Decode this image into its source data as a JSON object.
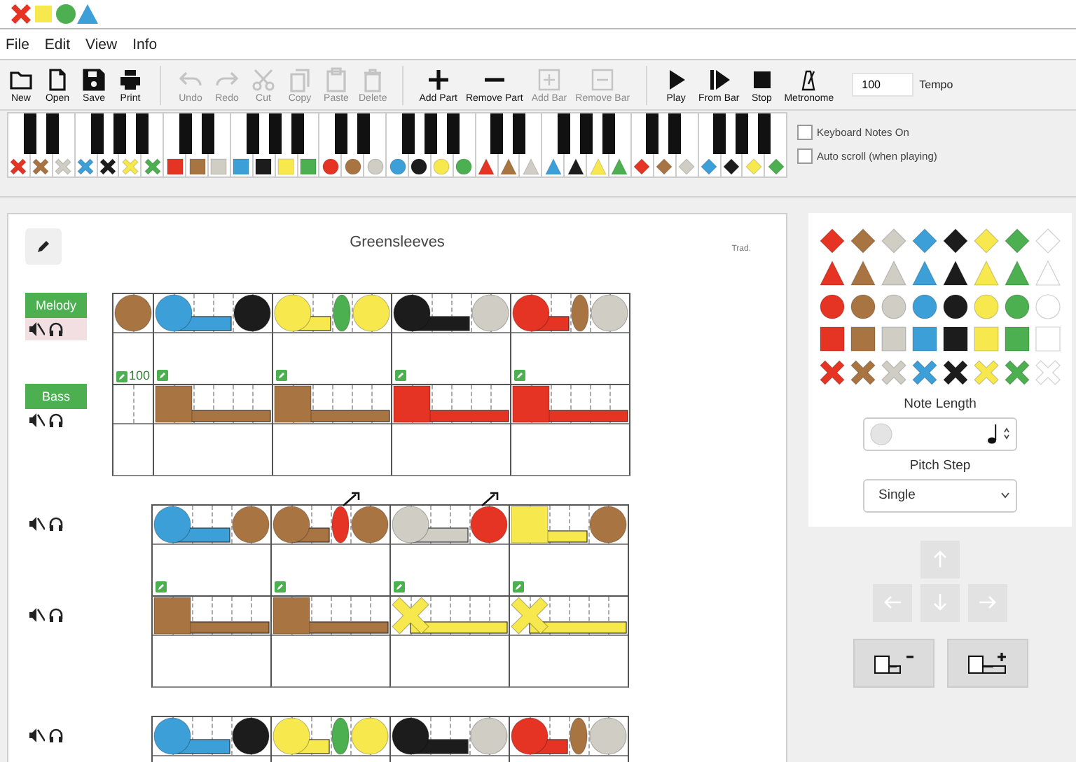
{
  "menu": [
    {
      "label": "File"
    },
    {
      "label": "Edit"
    },
    {
      "label": "View"
    },
    {
      "label": "Info"
    }
  ],
  "toolbar": {
    "groups": [
      {
        "items": [
          {
            "label": "New",
            "disabled": false
          },
          {
            "label": "Open",
            "disabled": false
          },
          {
            "label": "Save",
            "disabled": false
          },
          {
            "label": "Print",
            "disabled": false
          }
        ]
      },
      {
        "items": [
          {
            "label": "Undo",
            "disabled": true
          },
          {
            "label": "Redo",
            "disabled": true
          },
          {
            "label": "Cut",
            "disabled": true
          },
          {
            "label": "Copy",
            "disabled": true
          },
          {
            "label": "Paste",
            "disabled": true
          },
          {
            "label": "Delete",
            "disabled": true
          }
        ]
      },
      {
        "items": [
          {
            "label": "Add Part",
            "disabled": false
          },
          {
            "label": "Remove Part",
            "disabled": false
          },
          {
            "label": "Add Bar",
            "disabled": true
          },
          {
            "label": "Remove Bar",
            "disabled": true
          }
        ]
      },
      {
        "items": [
          {
            "label": "Play",
            "disabled": false
          },
          {
            "label": "From Bar",
            "disabled": false
          },
          {
            "label": "Stop",
            "disabled": false
          },
          {
            "label": "Metronome",
            "disabled": false
          }
        ]
      }
    ],
    "tempo": {
      "value": "100",
      "label": "Tempo"
    }
  },
  "keyboard": {
    "keys": [
      {
        "kind": "cross",
        "color": "#e53424"
      },
      {
        "kind": "cross",
        "color": "#a87542"
      },
      {
        "kind": "cross",
        "color": "#cfcdc4"
      },
      {
        "kind": "cross",
        "color": "#3d9fd8"
      },
      {
        "kind": "cross",
        "color": "#1c1c1c"
      },
      {
        "kind": "cross",
        "color": "#f7e84e"
      },
      {
        "kind": "cross",
        "color": "#4caf50"
      },
      {
        "kind": "square",
        "color": "#e53424"
      },
      {
        "kind": "square",
        "color": "#a87542"
      },
      {
        "kind": "square",
        "color": "#cfcdc4"
      },
      {
        "kind": "square",
        "color": "#3d9fd8"
      },
      {
        "kind": "square",
        "color": "#1c1c1c"
      },
      {
        "kind": "square",
        "color": "#f7e84e"
      },
      {
        "kind": "square",
        "color": "#4caf50"
      },
      {
        "kind": "circle",
        "color": "#e53424"
      },
      {
        "kind": "circle",
        "color": "#a87542"
      },
      {
        "kind": "circle",
        "color": "#cfcdc4"
      },
      {
        "kind": "circle",
        "color": "#3d9fd8"
      },
      {
        "kind": "circle",
        "color": "#1c1c1c"
      },
      {
        "kind": "circle",
        "color": "#f7e84e"
      },
      {
        "kind": "circle",
        "color": "#4caf50"
      },
      {
        "kind": "triangle",
        "color": "#e53424"
      },
      {
        "kind": "triangle",
        "color": "#a87542"
      },
      {
        "kind": "triangle",
        "color": "#cfcdc4"
      },
      {
        "kind": "triangle",
        "color": "#3d9fd8"
      },
      {
        "kind": "triangle",
        "color": "#1c1c1c"
      },
      {
        "kind": "triangle",
        "color": "#f7e84e"
      },
      {
        "kind": "triangle",
        "color": "#4caf50"
      },
      {
        "kind": "diamond",
        "color": "#e53424"
      },
      {
        "kind": "diamond",
        "color": "#a87542"
      },
      {
        "kind": "diamond",
        "color": "#cfcdc4"
      },
      {
        "kind": "diamond",
        "color": "#3d9fd8"
      },
      {
        "kind": "diamond",
        "color": "#1c1c1c"
      },
      {
        "kind": "diamond",
        "color": "#f7e84e"
      },
      {
        "kind": "diamond",
        "color": "#4caf50"
      }
    ],
    "options": [
      {
        "label": "Keyboard Notes On",
        "checked": false
      },
      {
        "label": "Auto scroll (when playing)",
        "checked": false
      }
    ]
  },
  "score": {
    "title": "Greensleeves",
    "composer": "Trad.",
    "systems": [
      {
        "parts": [
          {
            "name": "Melody",
            "selected": true,
            "bars": [
              {
                "kind": "pickup",
                "notes": [
                  {
                    "kind": "circle-quarter",
                    "color": "#a87542",
                    "raised": false
                  }
                ]
              },
              {
                "kind": "full",
                "notes": [
                  {
                    "kind": "circle-half",
                    "color": "#3d9fd8",
                    "raised": false
                  },
                  {
                    "kind": "circle-quarter",
                    "color": "#1c1c1c",
                    "raised": false
                  }
                ]
              },
              {
                "kind": "full",
                "notes": [
                  {
                    "kind": "circle-dotted-quarter",
                    "color": "#f7e84e",
                    "raised": false
                  },
                  {
                    "kind": "circle-eighth",
                    "color": "#4caf50",
                    "raised": false
                  },
                  {
                    "kind": "circle-quarter",
                    "color": "#f7e84e",
                    "raised": false
                  }
                ]
              },
              {
                "kind": "full",
                "notes": [
                  {
                    "kind": "circle-half",
                    "color": "#1c1c1c",
                    "raised": false
                  },
                  {
                    "kind": "circle-quarter",
                    "color": "#cfcdc4",
                    "raised": false
                  }
                ]
              },
              {
                "kind": "full",
                "notes": [
                  {
                    "kind": "circle-dotted-quarter",
                    "color": "#e53424",
                    "raised": false
                  },
                  {
                    "kind": "circle-eighth",
                    "color": "#a87542",
                    "raised": false
                  },
                  {
                    "kind": "circle-quarter",
                    "color": "#cfcdc4",
                    "raised": false
                  }
                ]
              }
            ]
          },
          {
            "name": "Bass",
            "selected": false,
            "bars": [
              {
                "kind": "pickup",
                "marker": true,
                "marker_label": "100"
              },
              {
                "kind": "full",
                "marker": true,
                "notes": [
                  {
                    "kind": "square-dotted-half",
                    "color": "#a87542",
                    "raised": false
                  }
                ]
              },
              {
                "kind": "full",
                "marker": true,
                "notes": [
                  {
                    "kind": "square-dotted-half",
                    "color": "#a87542",
                    "raised": false
                  }
                ]
              },
              {
                "kind": "full",
                "marker": true,
                "notes": [
                  {
                    "kind": "square-dotted-half",
                    "color": "#e53424",
                    "raised": false
                  }
                ]
              },
              {
                "kind": "full",
                "marker": true,
                "notes": [
                  {
                    "kind": "square-dotted-half",
                    "color": "#e53424",
                    "raised": false
                  }
                ]
              }
            ]
          }
        ]
      },
      {
        "parts": [
          {
            "selected": false,
            "bars": [
              {
                "kind": "full",
                "notes": [
                  {
                    "kind": "circle-half",
                    "color": "#3d9fd8",
                    "raised": false
                  },
                  {
                    "kind": "circle-quarter",
                    "color": "#a87542",
                    "raised": false
                  }
                ]
              },
              {
                "kind": "full",
                "notes": [
                  {
                    "kind": "circle-dotted-quarter",
                    "color": "#a87542",
                    "raised": false
                  },
                  {
                    "kind": "circle-eighth",
                    "color": "#e53424",
                    "raised": true
                  },
                  {
                    "kind": "circle-quarter",
                    "color": "#a87542",
                    "raised": false
                  }
                ]
              },
              {
                "kind": "full",
                "notes": [
                  {
                    "kind": "circle-half",
                    "color": "#cfcdc4",
                    "raised": false
                  },
                  {
                    "kind": "circle-quarter",
                    "color": "#e53424",
                    "raised": true
                  }
                ]
              },
              {
                "kind": "full",
                "notes": [
                  {
                    "kind": "square-half",
                    "color": "#f7e84e",
                    "raised": false
                  },
                  {
                    "kind": "circle-quarter",
                    "color": "#a87542",
                    "raised": false
                  }
                ]
              }
            ]
          },
          {
            "selected": false,
            "bars": [
              {
                "kind": "full",
                "marker": true,
                "notes": [
                  {
                    "kind": "square-dotted-half",
                    "color": "#a87542",
                    "raised": false
                  }
                ]
              },
              {
                "kind": "full",
                "marker": true,
                "notes": [
                  {
                    "kind": "square-dotted-half",
                    "color": "#a87542",
                    "raised": false
                  }
                ]
              },
              {
                "kind": "full",
                "marker": true,
                "notes": [
                  {
                    "kind": "cross-dotted-half",
                    "color": "#f7e84e",
                    "raised": false
                  }
                ]
              },
              {
                "kind": "full",
                "marker": true,
                "notes": [
                  {
                    "kind": "cross-dotted-half",
                    "color": "#f7e84e",
                    "raised": false
                  }
                ]
              }
            ]
          }
        ]
      },
      {
        "parts": [
          {
            "selected": false,
            "bars": [
              {
                "kind": "full",
                "notes": [
                  {
                    "kind": "circle-half",
                    "color": "#3d9fd8",
                    "raised": false
                  },
                  {
                    "kind": "circle-quarter",
                    "color": "#1c1c1c",
                    "raised": false
                  }
                ]
              },
              {
                "kind": "full",
                "notes": [
                  {
                    "kind": "circle-dotted-quarter",
                    "color": "#f7e84e",
                    "raised": false
                  },
                  {
                    "kind": "circle-eighth",
                    "color": "#4caf50",
                    "raised": false
                  },
                  {
                    "kind": "circle-quarter",
                    "color": "#f7e84e",
                    "raised": false
                  }
                ]
              },
              {
                "kind": "full",
                "notes": [
                  {
                    "kind": "circle-half",
                    "color": "#1c1c1c",
                    "raised": false
                  },
                  {
                    "kind": "circle-quarter",
                    "color": "#cfcdc4",
                    "raised": false
                  }
                ]
              },
              {
                "kind": "full",
                "notes": [
                  {
                    "kind": "circle-dotted-quarter",
                    "color": "#e53424",
                    "raised": false
                  },
                  {
                    "kind": "circle-eighth",
                    "color": "#a87542",
                    "raised": false
                  },
                  {
                    "kind": "circle-quarter",
                    "color": "#cfcdc4",
                    "raised": false
                  }
                ]
              }
            ]
          }
        ]
      }
    ]
  },
  "palette": {
    "rows": [
      {
        "kind": "diamond",
        "swatches": [
          {
            "color": "#e53424"
          },
          {
            "color": "#a87542"
          },
          {
            "color": "#cfcdc4"
          },
          {
            "color": "#3d9fd8"
          },
          {
            "color": "#1c1c1c"
          },
          {
            "color": "#f7e84e"
          },
          {
            "color": "#4caf50"
          },
          {
            "color": "#ffffff"
          }
        ]
      },
      {
        "kind": "triangle",
        "swatches": [
          {
            "color": "#e53424"
          },
          {
            "color": "#a87542"
          },
          {
            "color": "#cfcdc4"
          },
          {
            "color": "#3d9fd8"
          },
          {
            "color": "#1c1c1c"
          },
          {
            "color": "#f7e84e"
          },
          {
            "color": "#4caf50"
          },
          {
            "color": "#ffffff"
          }
        ]
      },
      {
        "kind": "circle",
        "swatches": [
          {
            "color": "#e53424"
          },
          {
            "color": "#a87542"
          },
          {
            "color": "#cfcdc4"
          },
          {
            "color": "#3d9fd8"
          },
          {
            "color": "#1c1c1c"
          },
          {
            "color": "#f7e84e"
          },
          {
            "color": "#4caf50"
          },
          {
            "color": "#ffffff"
          }
        ]
      },
      {
        "kind": "square",
        "swatches": [
          {
            "color": "#e53424"
          },
          {
            "color": "#a87542"
          },
          {
            "color": "#cfcdc4"
          },
          {
            "color": "#3d9fd8"
          },
          {
            "color": "#1c1c1c"
          },
          {
            "color": "#f7e84e"
          },
          {
            "color": "#4caf50"
          },
          {
            "color": "#ffffff"
          }
        ]
      },
      {
        "kind": "cross",
        "swatches": [
          {
            "color": "#e53424"
          },
          {
            "color": "#a87542"
          },
          {
            "color": "#cfcdc4"
          },
          {
            "color": "#3d9fd8"
          },
          {
            "color": "#1c1c1c"
          },
          {
            "color": "#f7e84e"
          },
          {
            "color": "#4caf50"
          },
          {
            "color": "#ffffff"
          }
        ]
      }
    ],
    "note_length": {
      "label": "Note Length"
    },
    "pitch_step": {
      "label": "Pitch Step",
      "value": "Single"
    }
  }
}
